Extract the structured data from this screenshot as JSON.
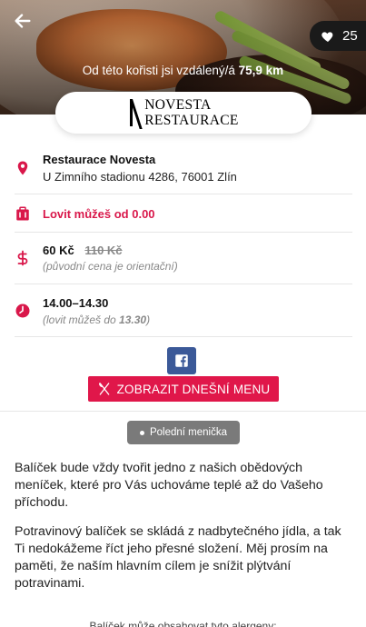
{
  "header": {
    "favorite_count": "25",
    "distance_prefix": "Od této kořisti jsi vzdálený/á",
    "distance_value": "75,9 km"
  },
  "logo": {
    "line1": "NOVESTA",
    "line2": "RESTAURACE"
  },
  "restaurant": {
    "name": "Restaurace Novesta",
    "address": "U Zimního stadionu 4286, 76001 Zlín"
  },
  "hunt": {
    "from_text": "Lovit můžeš od 0.00"
  },
  "price": {
    "current": "60 Kč",
    "original": "110 Kč",
    "note": "(původní cena je orientační)"
  },
  "time": {
    "range": "14.00–14.30",
    "note_prefix": "(lovit můžeš do ",
    "note_time": "13.30",
    "note_suffix": ")"
  },
  "actions": {
    "menu_button": "ZOBRAZIT DNEŠNÍ MENU"
  },
  "tag": "Polední menička",
  "description": {
    "p1": "Balíček bude vždy tvořit jedno z našich obědových meníček, které pro Vás uchováme teplé až do Vašeho příchodu.",
    "p2": "Potravinový balíček se skládá z nadbytečného jídla, a tak Ti nedokážeme říct jeho přesné složení. Měj prosím na paměti, že naším hlavním cílem je snížit plýtvání potravinami.",
    "p3": "Balíček může obsahovat tyto alergeny:"
  },
  "colors": {
    "accent": "#e0174a",
    "facebook": "#3b5998"
  },
  "icons": [
    "back-arrow-icon",
    "heart-icon",
    "location-pin-icon",
    "bag-icon",
    "dollar-icon",
    "clock-icon",
    "facebook-icon",
    "cutlery-icon"
  ]
}
